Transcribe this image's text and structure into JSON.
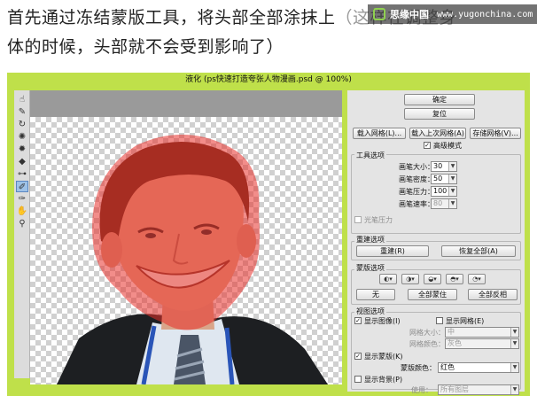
{
  "caption": {
    "line1": "首先通过冻结蒙版工具，将头部全部涂抹上",
    "line1_faded": "（这样在调整身",
    "line2": "体的时候，头部就不会受到影响了）"
  },
  "watermark": {
    "brand": "思缘中国",
    "url": "www.yugonchina.com"
  },
  "window": {
    "title": "液化 (ps快速打造夸张人物漫画.psd @ 100%)"
  },
  "toolbar": {
    "tools": [
      {
        "icon": "forward-warp-icon",
        "glyph": "☝"
      },
      {
        "icon": "reconstruct-icon",
        "glyph": "✎"
      },
      {
        "icon": "twirl-icon",
        "glyph": "↻"
      },
      {
        "icon": "pucker-icon",
        "glyph": "✺"
      },
      {
        "icon": "bloat-icon",
        "glyph": "✹"
      },
      {
        "icon": "push-left-icon",
        "glyph": "◆"
      },
      {
        "icon": "mirror-icon",
        "glyph": "⊶"
      },
      {
        "icon": "freeze-mask-icon",
        "glyph": "✐"
      },
      {
        "icon": "thaw-mask-icon",
        "glyph": "✑"
      },
      {
        "icon": "hand-icon",
        "glyph": "✋"
      },
      {
        "icon": "zoom-icon",
        "glyph": "⚲"
      }
    ]
  },
  "panel": {
    "ok": "确定",
    "reset": "复位",
    "load_mesh": "载入网格(L)...",
    "load_last_mesh": "载入上次网格(A)",
    "save_mesh": "存储网格(V)...",
    "advanced_mode": "高级模式",
    "tool_options": {
      "title": "工具选项",
      "brush_size_label": "画笔大小：",
      "brush_size": "30",
      "brush_density_label": "画笔密度：",
      "brush_density": "50",
      "brush_pressure_label": "画笔压力：",
      "brush_pressure": "100",
      "brush_rate_label": "画笔速率：",
      "brush_rate": "80",
      "stylus_pressure": "光笔压力"
    },
    "reconstruct": {
      "title": "重建选项",
      "reconstruct_button": "重建(R)",
      "restore_all": "恢复全部(A)"
    },
    "mask": {
      "title": "蒙版选项",
      "none": "无",
      "mask_all": "全部蒙住",
      "invert_all": "全部反相"
    },
    "view": {
      "title": "视图选项",
      "show_image": "显示图像(I)",
      "show_mesh": "显示网格(E)",
      "mesh_size_label": "网格大小：",
      "mesh_size": "中",
      "mesh_color_label": "网格颜色：",
      "mesh_color": "灰色",
      "show_mask": "显示蒙版(K)",
      "mask_color_label": "蒙版颜色：",
      "mask_color": "红色",
      "show_backdrop": "显示背景(P)",
      "use_label": "使用：",
      "use": "所有图层"
    }
  },
  "colors": {
    "window_border": "#bfe04a",
    "mask_overlay": "#e8302a",
    "panel_bg": "#e4e4e4"
  }
}
